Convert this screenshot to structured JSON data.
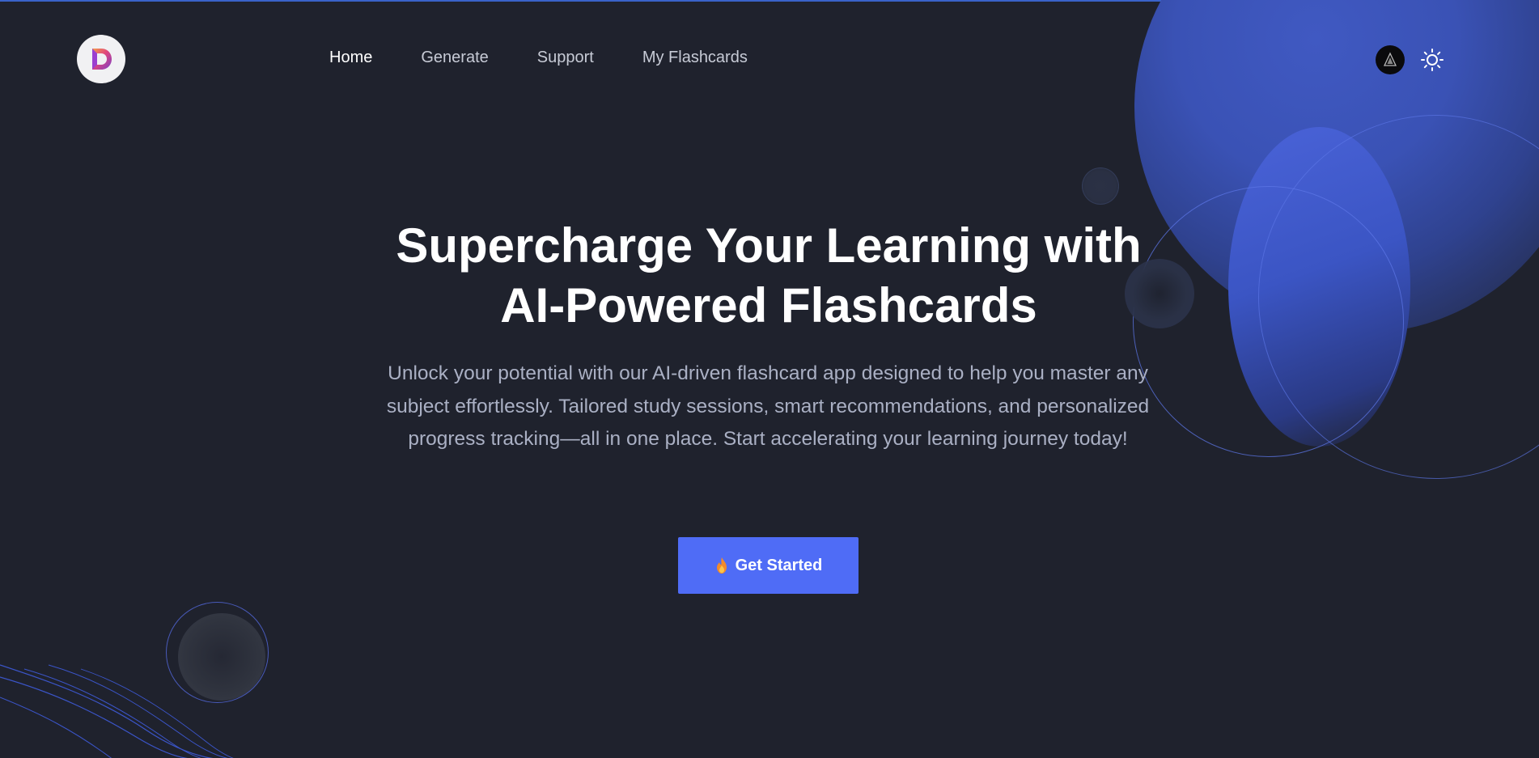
{
  "nav": {
    "items": [
      {
        "label": "Home",
        "active": true
      },
      {
        "label": "Generate",
        "active": false
      },
      {
        "label": "Support",
        "active": false
      },
      {
        "label": "My Flashcards",
        "active": false
      }
    ]
  },
  "brand": {
    "logo_icon": "d-logo-icon"
  },
  "header_actions": {
    "avatar_icon": "user-avatar-icon",
    "theme_icon": "sun-icon"
  },
  "hero": {
    "title_line1": "Supercharge Your Learning with",
    "title_line2": "AI-Powered Flashcards",
    "description": "Unlock your potential with our AI-driven flashcard app designed to help you master any subject effortlessly. Tailored study sessions, smart recommendations, and personalized progress tracking—all in one place. Start accelerating your learning journey today!",
    "cta_label": "Get Started",
    "cta_icon": "fire-icon"
  },
  "colors": {
    "background": "#1f222d",
    "accent": "#4f6cf6",
    "text_primary": "#ffffff",
    "text_muted": "#aab0c4"
  }
}
